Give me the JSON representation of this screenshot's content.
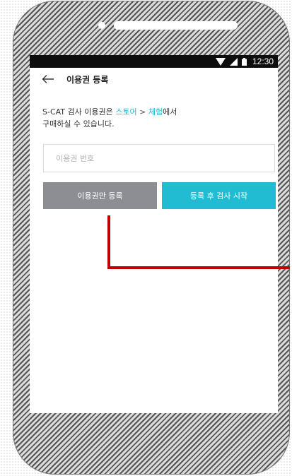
{
  "status_bar": {
    "time": "12:30",
    "icons": [
      "wifi-icon",
      "signal-icon",
      "battery-icon"
    ]
  },
  "app_bar": {
    "back_icon": "arrow-left-icon",
    "title": "이용권 등록"
  },
  "description": {
    "prefix": "S-CAT 검사 이용권은 ",
    "link_store": "스토어",
    "separator": " > ",
    "link_trial": "체험",
    "suffix": "에서",
    "line2": "구매하실 수 있습니다."
  },
  "code_input": {
    "value": "",
    "placeholder": "이용권 번호"
  },
  "buttons": {
    "register_only": "이용권만 등록",
    "register_and_start": "등록 후 검사 시작"
  },
  "colors": {
    "accent": "#21bcd2",
    "link": "#1fb8cc",
    "secondary_button": "#8c8e94",
    "annotation": "#c00000",
    "status_bar": "#0d0d0d"
  }
}
